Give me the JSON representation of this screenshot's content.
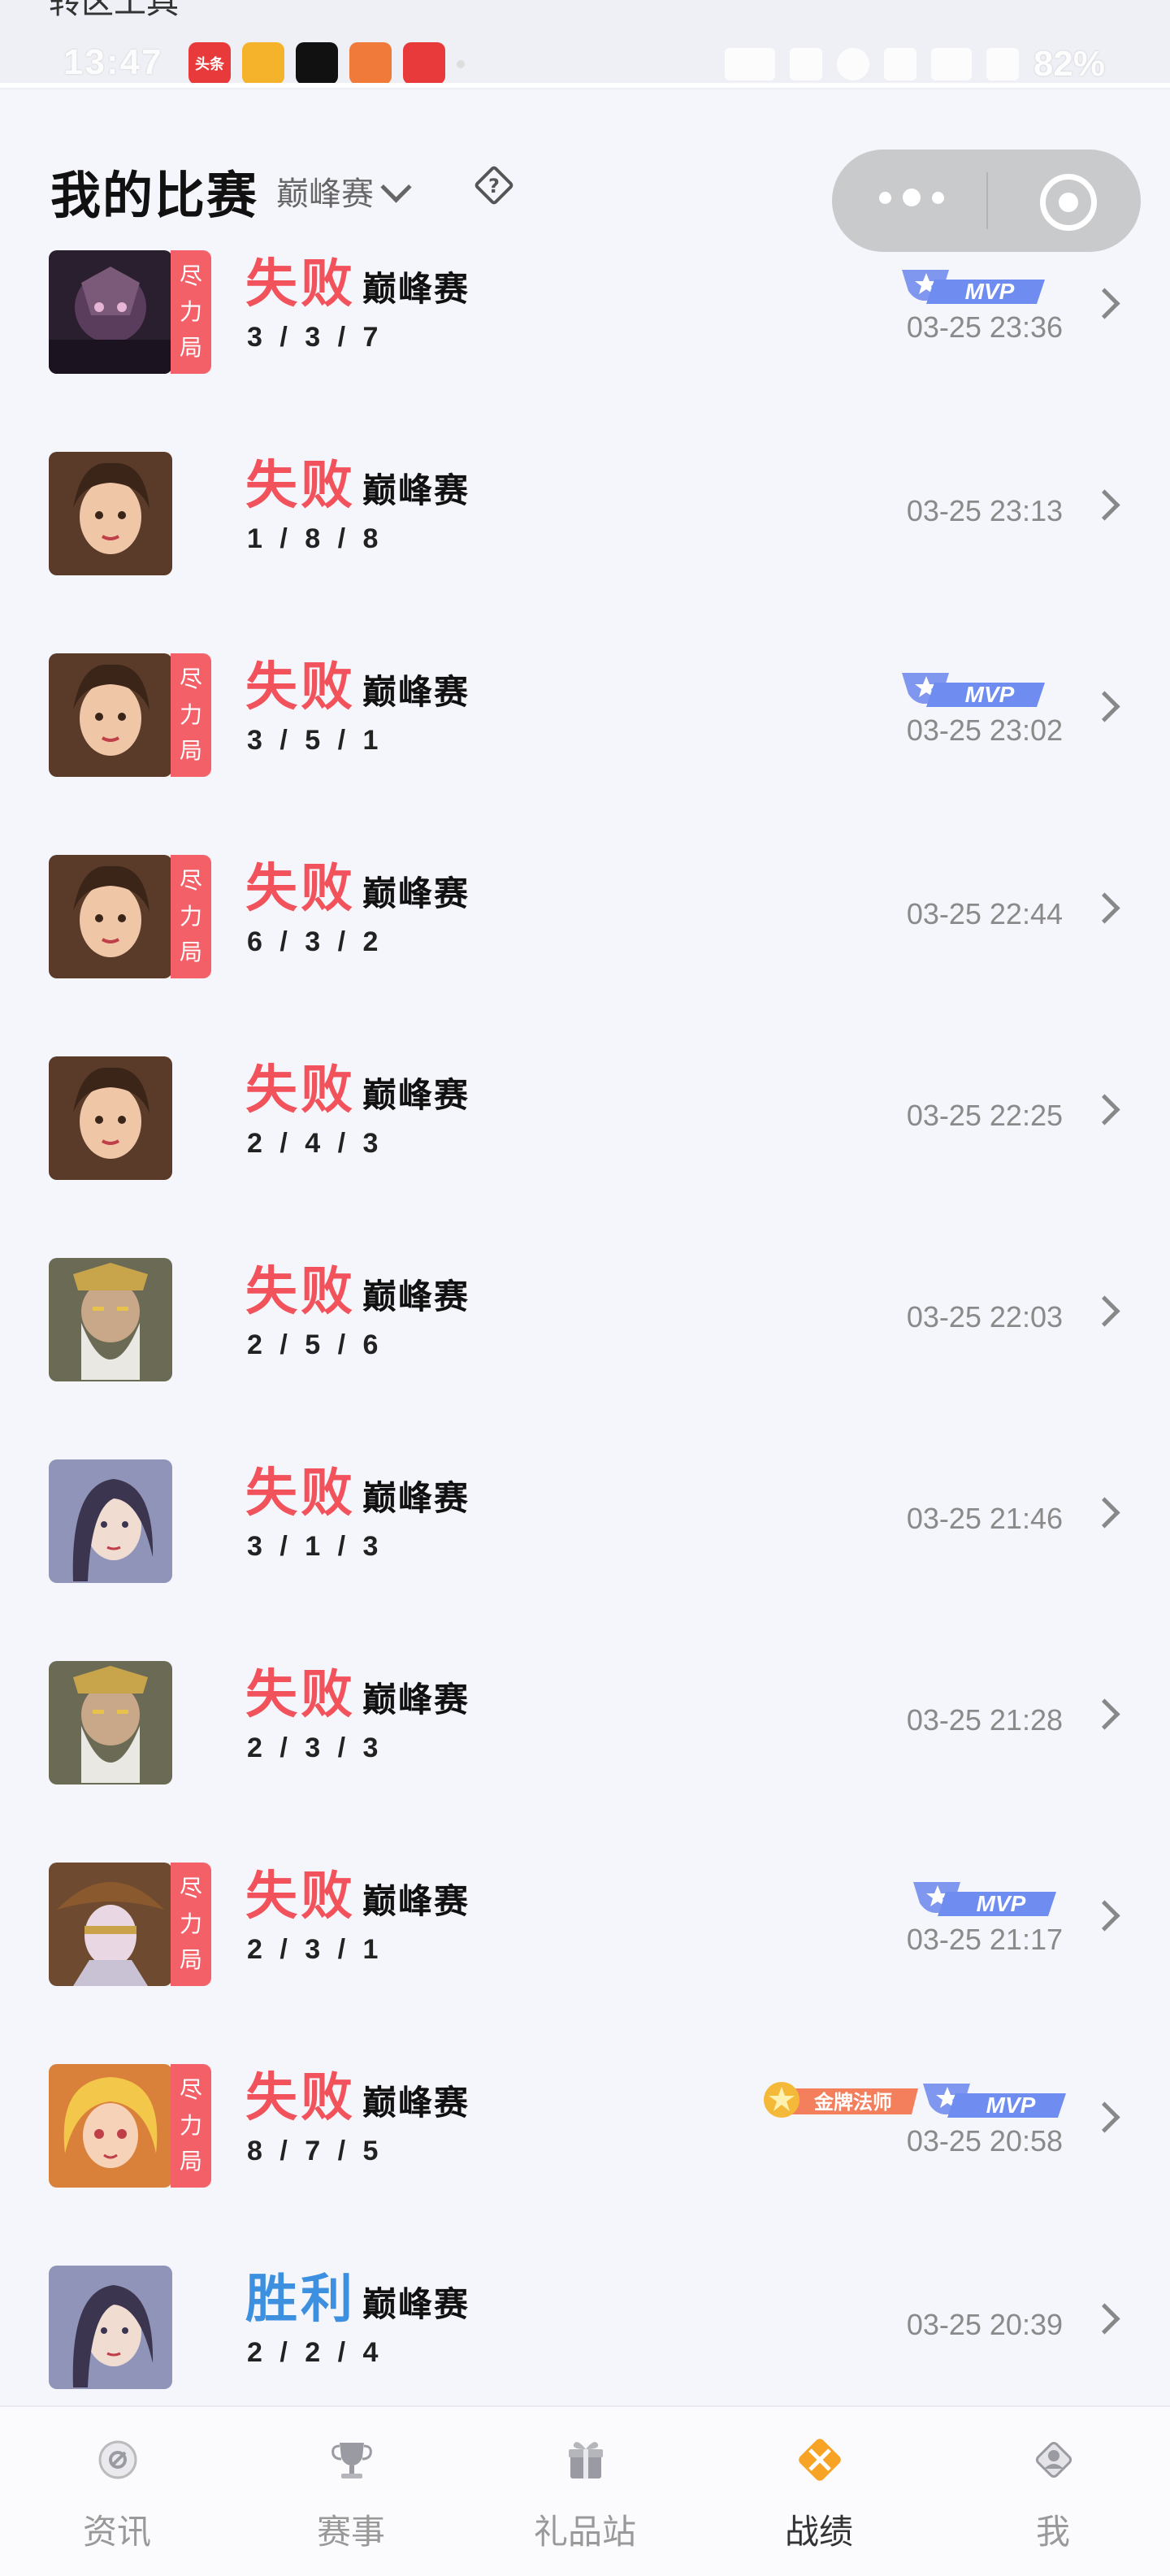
{
  "status_bar": {
    "overlay_text": "转区工具",
    "time": "13:47",
    "battery": "82%",
    "app_icons": [
      {
        "name": "toutiao-icon",
        "label": "头条",
        "color": "#e83a3a"
      },
      {
        "name": "weibo-icon",
        "label": "",
        "color": "#f5b32c"
      },
      {
        "name": "douyin-icon",
        "label": "",
        "color": "#111111"
      },
      {
        "name": "game-icon",
        "label": "",
        "color": "#f07a3a"
      },
      {
        "name": "bank-icon",
        "label": "",
        "color": "#e83a3a"
      }
    ]
  },
  "header": {
    "title": "我的比赛",
    "mode_filter": "巅峰赛"
  },
  "effort_tag_text": [
    "尽",
    "力",
    "局"
  ],
  "badges": {
    "mvp": "MVP",
    "gold": "金牌法师"
  },
  "matches": [
    {
      "result": "失败",
      "result_type": "loss",
      "mode": "巅峰赛",
      "kda": "3 / 3 / 7",
      "time": "03-25 23:36",
      "effort": true,
      "mvp": true,
      "gold": false,
      "avatar": "dark"
    },
    {
      "result": "失败",
      "result_type": "loss",
      "mode": "巅峰赛",
      "kda": "1 / 8 / 8",
      "time": "03-25 23:13",
      "effort": false,
      "mvp": false,
      "gold": false,
      "avatar": "girl"
    },
    {
      "result": "失败",
      "result_type": "loss",
      "mode": "巅峰赛",
      "kda": "3 / 5 / 1",
      "time": "03-25 23:02",
      "effort": true,
      "mvp": true,
      "gold": false,
      "avatar": "girl"
    },
    {
      "result": "失败",
      "result_type": "loss",
      "mode": "巅峰赛",
      "kda": "6 / 3 / 2",
      "time": "03-25 22:44",
      "effort": true,
      "mvp": false,
      "gold": false,
      "avatar": "girl"
    },
    {
      "result": "失败",
      "result_type": "loss",
      "mode": "巅峰赛",
      "kda": "2 / 4 / 3",
      "time": "03-25 22:25",
      "effort": false,
      "mvp": false,
      "gold": false,
      "avatar": "girl"
    },
    {
      "result": "失败",
      "result_type": "loss",
      "mode": "巅峰赛",
      "kda": "2 / 5 / 6",
      "time": "03-25 22:03",
      "effort": false,
      "mvp": false,
      "gold": false,
      "avatar": "oldman"
    },
    {
      "result": "失败",
      "result_type": "loss",
      "mode": "巅峰赛",
      "kda": "3 / 1 / 3",
      "time": "03-25 21:46",
      "effort": false,
      "mvp": false,
      "gold": false,
      "avatar": "silver"
    },
    {
      "result": "失败",
      "result_type": "loss",
      "mode": "巅峰赛",
      "kda": "2 / 3 / 3",
      "time": "03-25 21:28",
      "effort": false,
      "mvp": false,
      "gold": false,
      "avatar": "oldman"
    },
    {
      "result": "失败",
      "result_type": "loss",
      "mode": "巅峰赛",
      "kda": "2 / 3 / 1",
      "time": "03-25 21:17",
      "effort": true,
      "mvp": true,
      "gold": false,
      "avatar": "hat"
    },
    {
      "result": "失败",
      "result_type": "loss",
      "mode": "巅峰赛",
      "kda": "8 / 7 / 5",
      "time": "03-25 20:58",
      "effort": true,
      "mvp": true,
      "gold": true,
      "avatar": "blonde"
    },
    {
      "result": "胜利",
      "result_type": "win",
      "mode": "巅峰赛",
      "kda": "2 / 2 / 4",
      "time": "03-25 20:39",
      "effort": false,
      "mvp": false,
      "gold": false,
      "avatar": "silver"
    }
  ],
  "bottom_nav": [
    {
      "label": "资讯",
      "icon": "news-icon",
      "active": false
    },
    {
      "label": "赛事",
      "icon": "trophy-icon",
      "active": false
    },
    {
      "label": "礼品站",
      "icon": "gift-icon",
      "active": false
    },
    {
      "label": "战绩",
      "icon": "crossed-swords-icon",
      "active": true
    },
    {
      "label": "我",
      "icon": "profile-icon",
      "active": false
    }
  ],
  "colors": {
    "loss": "#f1525b",
    "win": "#3d8fe0",
    "effort_tag": "#f36068",
    "active_nav": "#f7a326",
    "mvp": "#6f8df0"
  }
}
